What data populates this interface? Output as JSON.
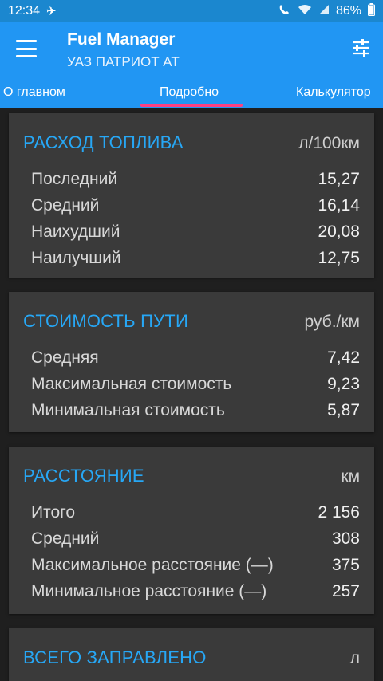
{
  "status_bar": {
    "time": "12:34",
    "battery": "86%",
    "colors": {
      "bg": "#1b87cf"
    }
  },
  "toolbar": {
    "title": "Fuel Manager",
    "subtitle": "УАЗ ПАТРИОТ АТ",
    "menu_icon": "hamburger-menu-icon",
    "tune_icon": "tune-sliders-icon"
  },
  "tabs": [
    {
      "label": "О главном",
      "selected": false
    },
    {
      "label": "Подробно",
      "selected": true
    },
    {
      "label": "Калькулятор",
      "selected": false
    }
  ],
  "colors": {
    "primary": "#2196f3",
    "accent": "#ff4081",
    "card_bg": "#3a3a3a",
    "page_bg": "#1f1f1f",
    "section_title": "#27a7f5"
  },
  "sections": [
    {
      "title": "РАСХОД ТОПЛИВА",
      "unit": "л/100км",
      "rows": [
        {
          "label": "Последний",
          "value": "15,27"
        },
        {
          "label": "Средний",
          "value": "16,14"
        },
        {
          "label": "Наихудший",
          "value": "20,08"
        },
        {
          "label": "Наилучший",
          "value": "12,75"
        }
      ]
    },
    {
      "title": "СТОИМОСТЬ ПУТИ",
      "unit": "руб./км",
      "rows": [
        {
          "label": "Средняя",
          "value": "7,42"
        },
        {
          "label": "Максимальная стоимость",
          "value": "9,23"
        },
        {
          "label": "Минимальная стоимость",
          "value": "5,87"
        }
      ]
    },
    {
      "title": "РАССТОЯНИЕ",
      "unit": "км",
      "rows": [
        {
          "label": "Итого",
          "value": "2 156"
        },
        {
          "label": "Средний",
          "value": "308"
        },
        {
          "label": "Максимальное расстояние (—)",
          "value": "375"
        },
        {
          "label": "Минимальное расстояние (—)",
          "value": "257"
        }
      ]
    },
    {
      "title": "ВСЕГО ЗАПРАВЛЕНО",
      "unit": "л",
      "rows": []
    }
  ]
}
